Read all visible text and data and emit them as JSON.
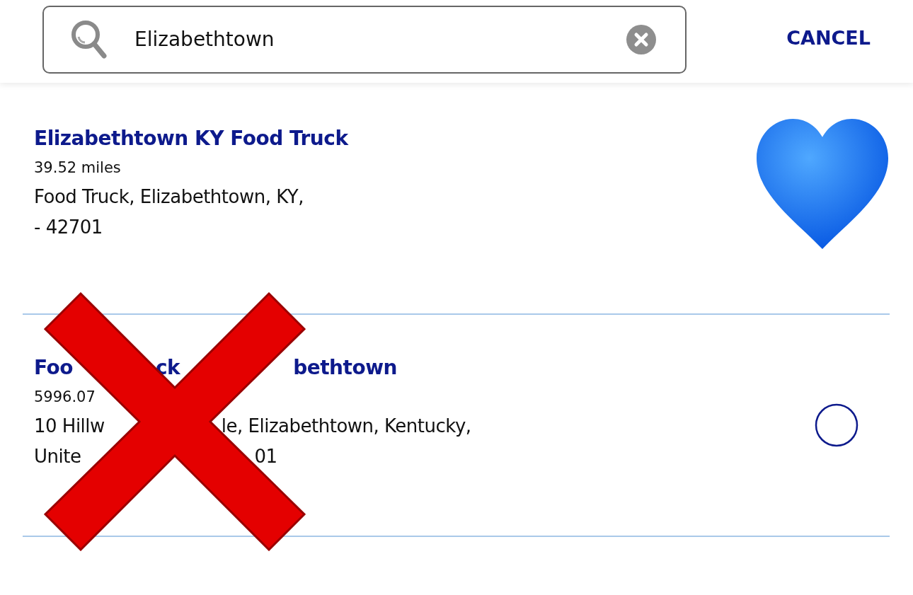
{
  "search": {
    "value": "Elizabethtown",
    "cancel": "CANCEL"
  },
  "results": [
    {
      "title": [
        "Elizabethtown KY Food Truck"
      ],
      "distance": [
        "39.52 miles"
      ],
      "address": [
        [
          "Food Truck, Elizabethtown, KY,"
        ],
        [
          "- 42701"
        ]
      ],
      "favorite": true
    },
    {
      "title": [
        "Foo",
        "ck",
        "bethtown"
      ],
      "distance": [
        "5996.07"
      ],
      "address": [
        [
          "10 Hillw",
          "le, Elizabethtown, Kentucky,"
        ],
        [
          "Unite",
          "01"
        ]
      ],
      "favorite": false
    }
  ],
  "overlay": {
    "kind": "cross-mark"
  }
}
